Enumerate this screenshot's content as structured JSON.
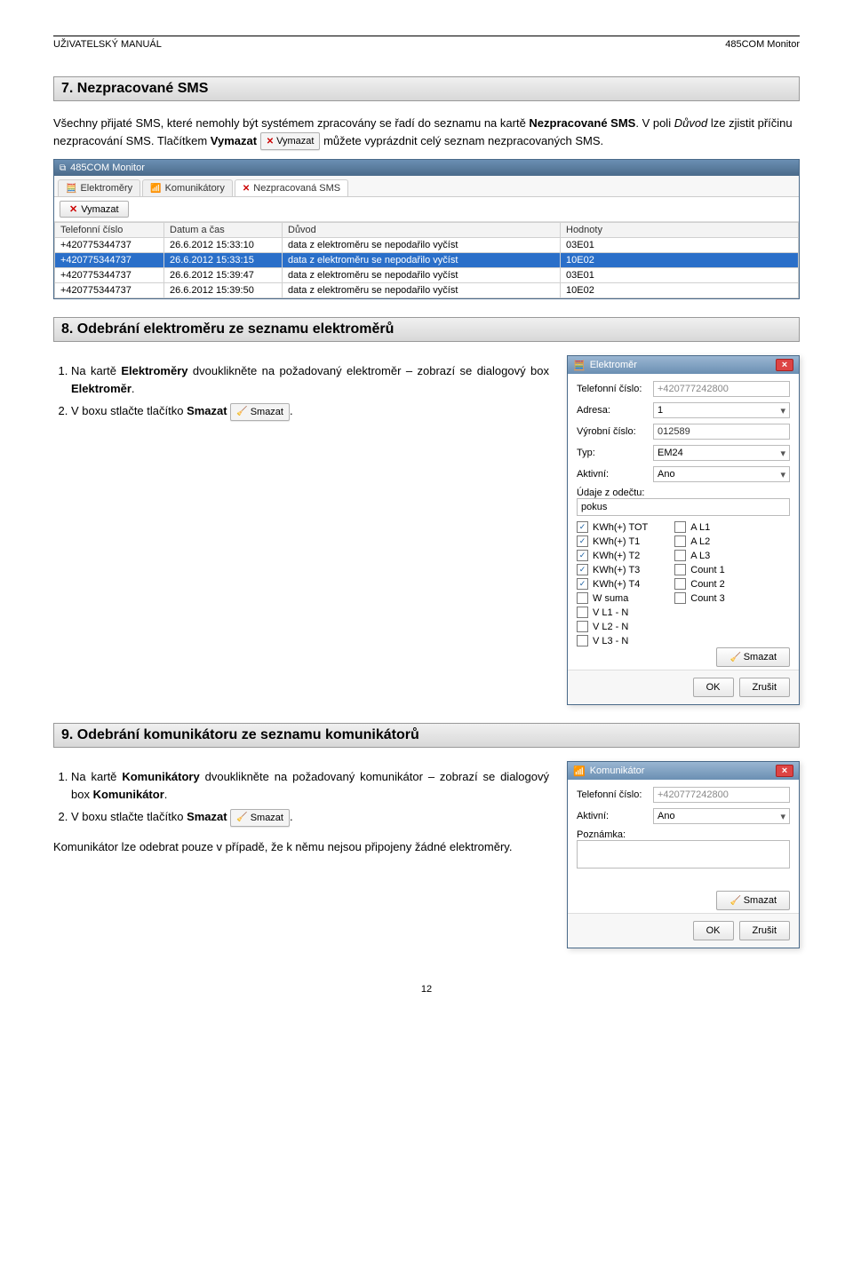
{
  "header": {
    "left": "UŽIVATELSKÝ MANUÁL",
    "right": "485COM Monitor"
  },
  "sections": {
    "s7": {
      "title": "7. Nezpracované SMS",
      "para_parts": {
        "t1": "Všechny přijaté SMS, které nemohly být systémem zpracovány se řadí do seznamu na kartě ",
        "b1": "Nezpracované SMS",
        "t2": ". V poli ",
        "i1": "Důvod",
        "t3": " lze zjistit příčinu nezpracování SMS. Tlačítkem ",
        "b2": "Vymazat",
        "btn": "Vymazat",
        "t4": " můžete vyprázdnit celý seznam nezpracovaných SMS."
      }
    },
    "s8": {
      "title": "8. Odebrání elektroměru ze seznamu elektroměrů",
      "step1_parts": {
        "t1": "Na kartě ",
        "b1": "Elektroměry",
        "t2": " dvouklikněte na požadovaný elektroměr – zobrazí se dialogový box ",
        "b2": "Elektroměr",
        "t3": "."
      },
      "step2_parts": {
        "t1": "V boxu stlačte tlačítko ",
        "b1": "Smazat",
        "btn": "Smazat",
        "t2": "."
      }
    },
    "s9": {
      "title": "9. Odebrání komunikátoru ze seznamu komunikátorů",
      "step1_parts": {
        "t1": "Na kartě ",
        "b1": "Komunikátory",
        "t2": " dvouklikněte na požadovaný komunikátor – zobrazí se dialogový box ",
        "b2": "Komunikátor",
        "t3": "."
      },
      "step2_parts": {
        "t1": "V boxu stlačte tlačítko ",
        "b1": "Smazat",
        "btn": "Smazat",
        "t2": "."
      },
      "note": "Komunikátor lze odebrat pouze v případě, že k němu nejsou připojeny žádné elektroměry."
    }
  },
  "app": {
    "title": "485COM Monitor",
    "tabs": {
      "t1": "Elektroměry",
      "t2": "Komunikátory",
      "t3": "Nezpracovaná SMS"
    },
    "toolbar": {
      "vymazat": "Vymazat"
    },
    "cols": {
      "phone": "Telefonní číslo",
      "date": "Datum a čas",
      "reason": "Důvod",
      "values": "Hodnoty"
    },
    "rows": [
      {
        "phone": "+420775344737",
        "date": "26.6.2012 15:33:10",
        "reason": "data z elektroměru se nepodařilo vyčíst",
        "values": "03E01"
      },
      {
        "phone": "+420775344737",
        "date": "26.6.2012 15:33:15",
        "reason": "data z elektroměru se nepodařilo vyčíst",
        "values": "10E02"
      },
      {
        "phone": "+420775344737",
        "date": "26.6.2012 15:39:47",
        "reason": "data z elektroměru se nepodařilo vyčíst",
        "values": "03E01"
      },
      {
        "phone": "+420775344737",
        "date": "26.6.2012 15:39:50",
        "reason": "data z elektroměru se nepodařilo vyčíst",
        "values": "10E02"
      }
    ]
  },
  "dialog_elektromer": {
    "title": "Elektroměr",
    "fields": {
      "phone_l": "Telefonní číslo:",
      "phone_v": "+420777242800",
      "adresa_l": "Adresa:",
      "adresa_v": "1",
      "vyrobni_l": "Výrobní číslo:",
      "vyrobni_v": "012589",
      "typ_l": "Typ:",
      "typ_v": "EM24",
      "aktivni_l": "Aktivní:",
      "aktivni_v": "Ano",
      "udaje_l": "Údaje z odečtu:",
      "udaje_v": "pokus"
    },
    "checks_left": [
      {
        "l": "KWh(+) TOT",
        "c": true
      },
      {
        "l": "KWh(+) T1",
        "c": true
      },
      {
        "l": "KWh(+) T2",
        "c": true
      },
      {
        "l": "KWh(+) T3",
        "c": true
      },
      {
        "l": "KWh(+) T4",
        "c": true
      },
      {
        "l": "W suma",
        "c": false
      },
      {
        "l": "V L1 - N",
        "c": false
      },
      {
        "l": "V L2 - N",
        "c": false
      },
      {
        "l": "V L3 - N",
        "c": false
      }
    ],
    "checks_right": [
      {
        "l": "A L1",
        "c": false
      },
      {
        "l": "A L2",
        "c": false
      },
      {
        "l": "A L3",
        "c": false
      },
      {
        "l": "Count 1",
        "c": false
      },
      {
        "l": "Count 2",
        "c": false
      },
      {
        "l": "Count 3",
        "c": false
      }
    ],
    "smazat": "Smazat",
    "ok": "OK",
    "zrusit": "Zrušit"
  },
  "dialog_komunikator": {
    "title": "Komunikátor",
    "phone_l": "Telefonní číslo:",
    "phone_v": "+420777242800",
    "aktivni_l": "Aktivní:",
    "aktivni_v": "Ano",
    "pozn_l": "Poznámka:",
    "pozn_v": "",
    "smazat": "Smazat",
    "ok": "OK",
    "zrusit": "Zrušit"
  },
  "page_num": "12"
}
